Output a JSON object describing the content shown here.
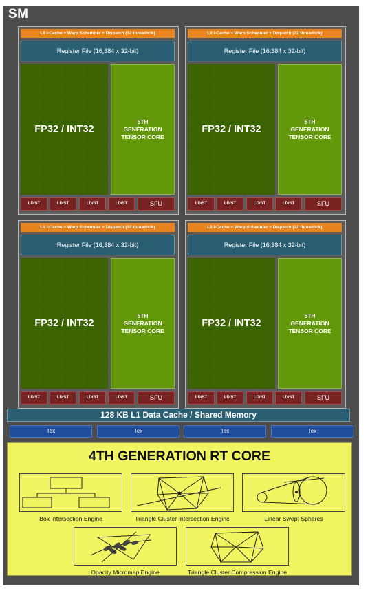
{
  "sm": {
    "title": "SM"
  },
  "partitions": [
    {
      "dispatch": "L0 i-Cache + Warp Scheduler + Dispatch (32 thread/clk)",
      "register_file": "Register File (16,384 x 32-bit)",
      "fp_label": "FP32 / INT32",
      "tensor_label": "5TH\nGENERATION\nTENSOR CORE",
      "ldst": [
        "LD/ST",
        "LD/ST",
        "LD/ST",
        "LD/ST"
      ],
      "sfu": "SFU"
    },
    {
      "dispatch": "L0 i-Cache + Warp Scheduler + Dispatch (32 thread/clk)",
      "register_file": "Register File (16,384 x 32-bit)",
      "fp_label": "FP32 / INT32",
      "tensor_label": "5TH\nGENERATION\nTENSOR CORE",
      "ldst": [
        "LD/ST",
        "LD/ST",
        "LD/ST",
        "LD/ST"
      ],
      "sfu": "SFU"
    },
    {
      "dispatch": "L0 i-Cache + Warp Scheduler + Dispatch (32 thread/clk)",
      "register_file": "Register File (16,384 x 32-bit)",
      "fp_label": "FP32 / INT32",
      "tensor_label": "5TH\nGENERATION\nTENSOR CORE",
      "ldst": [
        "LD/ST",
        "LD/ST",
        "LD/ST",
        "LD/ST"
      ],
      "sfu": "SFU"
    },
    {
      "dispatch": "L0 i-Cache + Warp Scheduler + Dispatch (32 thread/clk)",
      "register_file": "Register File (16,384 x 32-bit)",
      "fp_label": "FP32 / INT32",
      "tensor_label": "5TH\nGENERATION\nTENSOR CORE",
      "ldst": [
        "LD/ST",
        "LD/ST",
        "LD/ST",
        "LD/ST"
      ],
      "sfu": "SFU"
    }
  ],
  "l1_cache": "128 KB L1 Data Cache / Shared Memory",
  "tex_units": [
    "Tex",
    "Tex",
    "Tex",
    "Tex"
  ],
  "rt_core": {
    "title": "4TH GENERATION RT CORE",
    "engines": [
      {
        "label": "Box Intersection Engine",
        "icon": "box-hierarchy-icon"
      },
      {
        "label": "Triangle Cluster Intersection Engine",
        "icon": "triangle-mesh-ray-icon"
      },
      {
        "label": "Linear Swept Spheres",
        "icon": "swept-sphere-icon"
      },
      {
        "label": "Opacity Micromap Engine",
        "icon": "foliage-micromap-icon"
      },
      {
        "label": "Triangle Cluster Compression Engine",
        "icon": "triangle-mesh-icon"
      }
    ]
  },
  "colors": {
    "frame": "#4d4d4d",
    "dispatch": "#e9831e",
    "register_file": "#2a5e72",
    "fp_core": "#3d6402",
    "tensor_core": "#62980a",
    "ldst_sfu": "#7a2323",
    "tex": "#1f4d9e",
    "rt_core": "#f0f460"
  }
}
